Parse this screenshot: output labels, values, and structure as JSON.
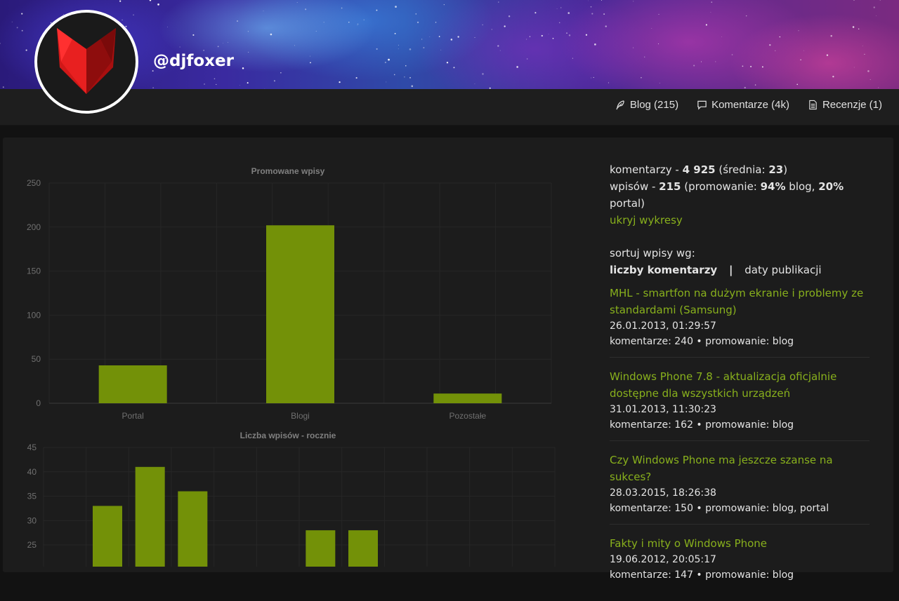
{
  "profile": {
    "username": "@djfoxer"
  },
  "nav": [
    {
      "label": "Blog (215)",
      "icon": "feather-icon"
    },
    {
      "label": "Komentarze (4k)",
      "icon": "comment-icon"
    },
    {
      "label": "Recenzje (1)",
      "icon": "document-icon"
    }
  ],
  "stats": {
    "comments_prefix": "komentarzy - ",
    "comments_total": "4 925",
    "comments_avg_prefix": " (średnia: ",
    "comments_avg": "23",
    "comments_suffix": ")",
    "posts_prefix": "wpisów - ",
    "posts_total": "215",
    "posts_promo_prefix": " (promowanie: ",
    "posts_blog_pct": "94%",
    "posts_blog_label": " blog, ",
    "posts_portal_pct": "20%",
    "posts_portal_label": " portal)",
    "hide_charts": "ukryj wykresy"
  },
  "sort": {
    "label": "sortuj wpisy wg:",
    "by_comments": "liczby komentarzy",
    "separator": "|",
    "by_date": "daty publikacji"
  },
  "posts": [
    {
      "title": "MHL - smartfon na dużym ekranie i problemy ze standardami (Samsung)",
      "date": "26.01.2013, 01:29:57",
      "meta": "komentarze: 240 • promowanie: blog"
    },
    {
      "title": "Windows Phone 7.8 - aktualizacja oficjalnie dostępne dla wszystkich urządzeń",
      "date": "31.01.2013, 11:30:23",
      "meta": "komentarze: 162 • promowanie: blog"
    },
    {
      "title": "Czy Windows Phone ma jeszcze szanse na sukces?",
      "date": "28.03.2015, 18:26:38",
      "meta": "komentarze: 150 • promowanie: blog, portal"
    },
    {
      "title": "Fakty i mity o Windows Phone",
      "date": "19.06.2012, 20:05:17",
      "meta": "komentarze: 147 • promowanie: blog"
    }
  ],
  "colors": {
    "accent": "#88b01c",
    "bar": "#739108"
  },
  "chart_data": [
    {
      "type": "bar",
      "title": "Promowane wpisy",
      "categories": [
        "Portal",
        "Blogi",
        "Pozostałe"
      ],
      "values": [
        43,
        202,
        11
      ],
      "ylim": [
        0,
        250
      ],
      "yticks": [
        0,
        50,
        100,
        150,
        200,
        250
      ],
      "grid": true
    },
    {
      "type": "bar",
      "title": "Liczba wpisów - rocznie",
      "values": [
        0,
        33,
        41,
        36,
        0,
        0,
        28,
        28,
        0,
        0,
        0,
        0
      ],
      "ylim": [
        0,
        45
      ],
      "yticks": [
        25,
        30,
        35,
        40,
        45
      ],
      "grid": true
    }
  ]
}
